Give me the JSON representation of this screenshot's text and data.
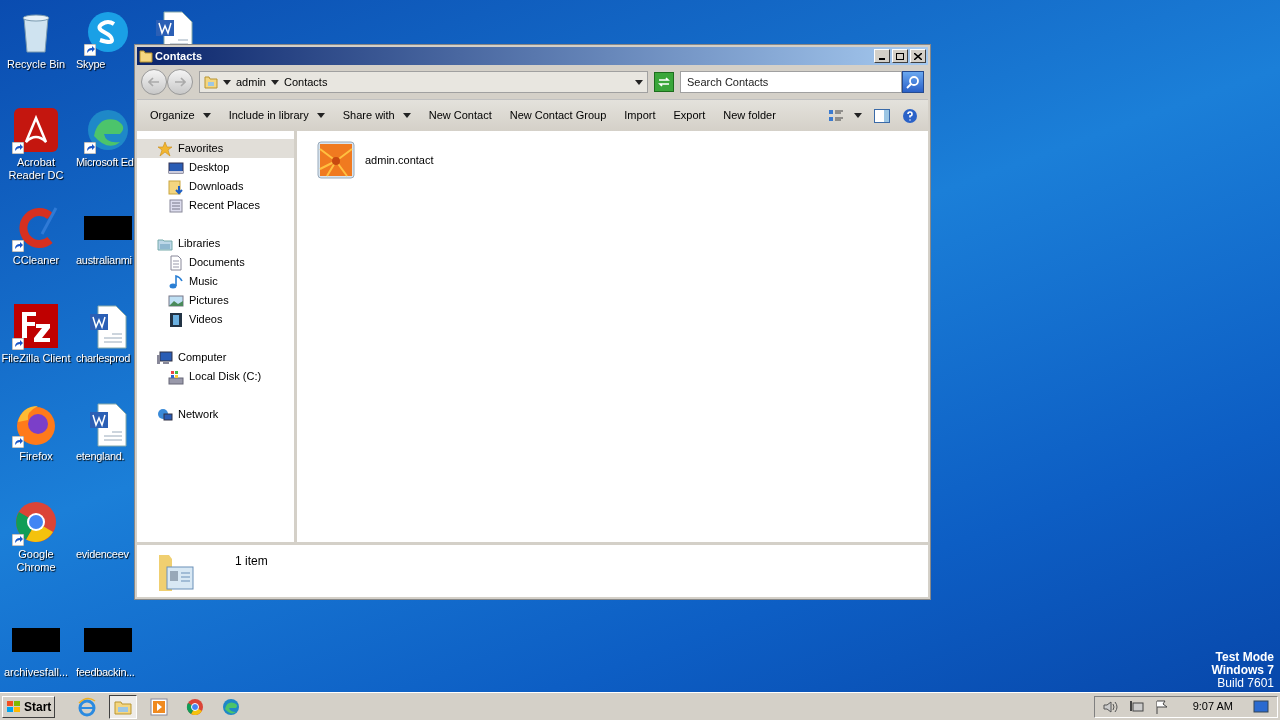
{
  "desktop": {
    "rows": [
      [
        {
          "kind": "recycle",
          "label": "Recycle Bin"
        },
        {
          "kind": "skype",
          "label": "Skype",
          "shortcut": true
        },
        {
          "kind": "word"
        }
      ],
      [
        {
          "kind": "acrobat",
          "label": "Acrobat Reader DC",
          "shortcut": true
        },
        {
          "kind": "edge",
          "label": "Microsoft Ed",
          "shortcut": true
        }
      ],
      [
        {
          "kind": "ccleaner",
          "label": "CCleaner",
          "shortcut": true
        },
        {
          "kind": "redacted",
          "label": "australianmi"
        }
      ],
      [
        {
          "kind": "filezilla",
          "label": "FileZilla Client",
          "shortcut": true
        },
        {
          "kind": "word",
          "label": "charlesprod"
        }
      ],
      [
        {
          "kind": "firefox",
          "label": "Firefox",
          "shortcut": true
        },
        {
          "kind": "word",
          "label": "etengland."
        }
      ],
      [
        {
          "kind": "chrome",
          "label": "Google Chrome",
          "shortcut": true
        },
        {
          "kind": "blank",
          "label": "evidenceev"
        }
      ],
      [
        {
          "kind": "redacted",
          "label": "archivesfall..."
        },
        {
          "kind": "redacted",
          "label": "feedbackin..."
        }
      ]
    ]
  },
  "window": {
    "title": "Contacts",
    "address": {
      "path": [
        "admin",
        "Contacts"
      ]
    },
    "search": {
      "placeholder": "Search Contacts"
    },
    "toolbar": [
      {
        "label": "Organize",
        "dropdown": true
      },
      {
        "label": "Include in library",
        "dropdown": true
      },
      {
        "label": "Share with",
        "dropdown": true
      },
      {
        "label": "New Contact",
        "dropdown": false
      },
      {
        "label": "New Contact Group",
        "dropdown": false
      },
      {
        "label": "Import",
        "dropdown": false
      },
      {
        "label": "Export",
        "dropdown": false
      },
      {
        "label": "New folder",
        "dropdown": false
      }
    ],
    "nav": [
      {
        "kind": "star",
        "label": "Favorites",
        "selected": true,
        "children": [
          {
            "kind": "desktop",
            "label": "Desktop",
            "selected": false
          },
          {
            "kind": "downloads",
            "label": "Downloads",
            "selected": false
          },
          {
            "kind": "recent",
            "label": "Recent Places",
            "selected": false
          }
        ]
      },
      {
        "kind": "libraries",
        "label": "Libraries",
        "selected": false,
        "children": [
          {
            "kind": "document",
            "label": "Documents",
            "selected": false
          },
          {
            "kind": "music",
            "label": "Music",
            "selected": false
          },
          {
            "kind": "pictures",
            "label": "Pictures",
            "selected": false
          },
          {
            "kind": "videos",
            "label": "Videos",
            "selected": false
          }
        ]
      },
      {
        "kind": "computer",
        "label": "Computer",
        "selected": false,
        "children": [
          {
            "kind": "disk",
            "label": "Local Disk (C:)",
            "selected": false
          }
        ]
      },
      {
        "kind": "network",
        "label": "Network",
        "selected": false
      }
    ],
    "items": [
      {
        "name": "admin.contact"
      }
    ],
    "status": "1 item"
  },
  "taskbar": {
    "start": "Start",
    "apps": [
      {
        "kind": "ie",
        "selected": false
      },
      {
        "kind": "explorer",
        "selected": true
      },
      {
        "kind": "media",
        "selected": false
      },
      {
        "kind": "chrome",
        "selected": false
      },
      {
        "kind": "edge",
        "selected": false
      }
    ],
    "time": "9:07 AM"
  },
  "os_notice": [
    "Test Mode",
    "Windows 7",
    "Build 7601"
  ]
}
